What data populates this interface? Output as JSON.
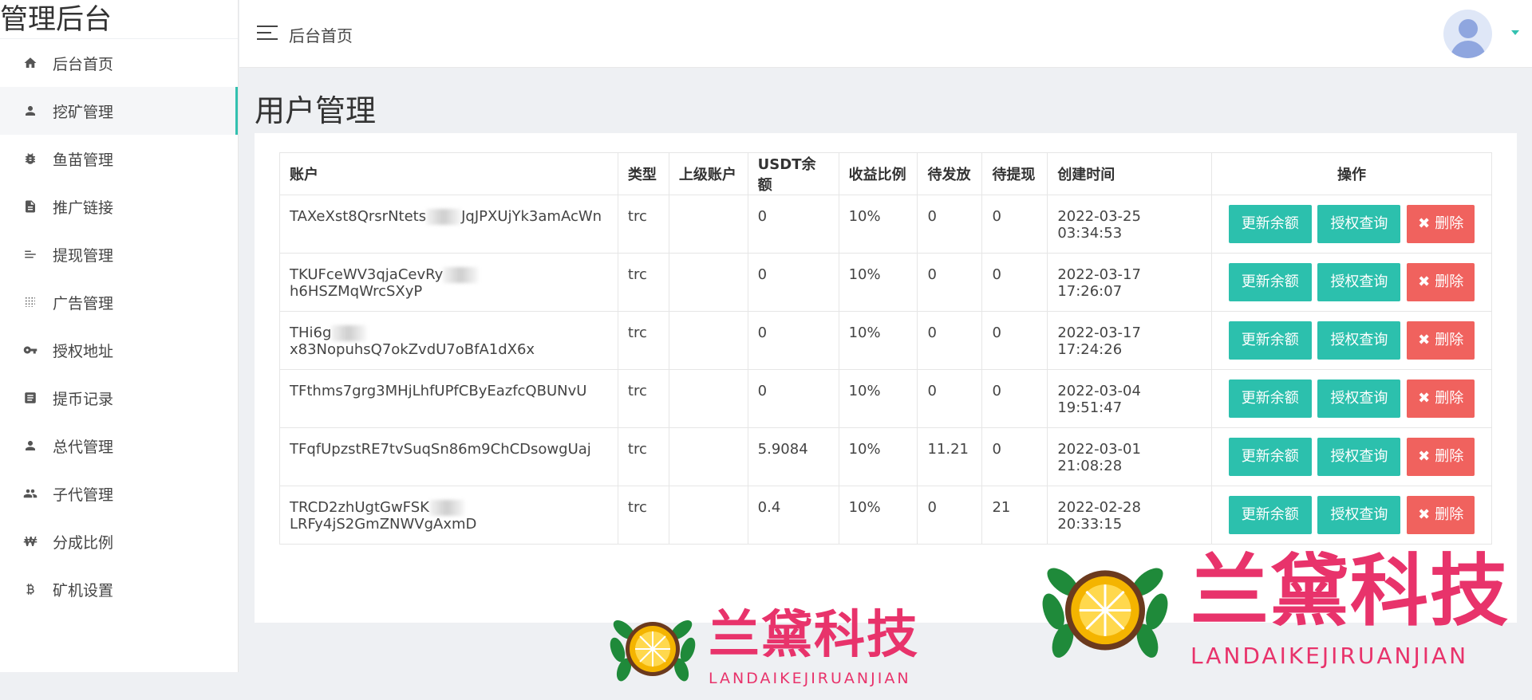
{
  "brand": "管理后台",
  "sidebar": {
    "items": [
      {
        "label": "后台首页",
        "icon": "home-icon"
      },
      {
        "label": "挖矿管理",
        "icon": "person-icon",
        "active": true
      },
      {
        "label": "鱼苗管理",
        "icon": "bug-icon"
      },
      {
        "label": "推广链接",
        "icon": "document-icon"
      },
      {
        "label": "提现管理",
        "icon": "list-icon"
      },
      {
        "label": "广告管理",
        "icon": "grid-dots-icon"
      },
      {
        "label": "授权地址",
        "icon": "key-icon"
      },
      {
        "label": "提币记录",
        "icon": "record-icon"
      },
      {
        "label": "总代管理",
        "icon": "person-icon"
      },
      {
        "label": "子代管理",
        "icon": "people-icon"
      },
      {
        "label": "分成比例",
        "icon": "won-icon"
      },
      {
        "label": "矿机设置",
        "icon": "bitcoin-icon"
      }
    ]
  },
  "header": {
    "title": "后台首页"
  },
  "page": {
    "title": "用户管理"
  },
  "table": {
    "headers": {
      "account": "账户",
      "type": "类型",
      "parent": "上级账户",
      "usdt": "USDT余额",
      "ratio": "收益比例",
      "pending": "待发放",
      "withdraw": "待提现",
      "created": "创建时间",
      "ops": "操作"
    },
    "rows": [
      {
        "account_a": "TAXeXst8QrsrNtets",
        "account_b": "JqJPXUjYk3amAcWn",
        "type": "trc",
        "parent": "",
        "usdt": "0",
        "ratio": "10%",
        "pending": "0",
        "withdraw": "0",
        "created": "2022-03-25 03:34:53"
      },
      {
        "account_a": "TKUFceWV3qjaCevRy",
        "account_b": "h6HSZMqWrcSXyP",
        "type": "trc",
        "parent": "",
        "usdt": "0",
        "ratio": "10%",
        "pending": "0",
        "withdraw": "0",
        "created": "2022-03-17 17:26:07"
      },
      {
        "account_a": "THi6g",
        "account_b": "x83NopuhsQ7okZvdU7oBfA1dX6x",
        "type": "trc",
        "parent": "",
        "usdt": "0",
        "ratio": "10%",
        "pending": "0",
        "withdraw": "0",
        "created": "2022-03-17 17:24:26"
      },
      {
        "account_a": "TFthms7grg3MHjLhfUPfCByEazfcQBUNvU",
        "account_b": "",
        "type": "trc",
        "parent": "",
        "usdt": "0",
        "ratio": "10%",
        "pending": "0",
        "withdraw": "0",
        "created": "2022-03-04 19:51:47"
      },
      {
        "account_a": "TFqfUpzstRE7tvSuqSn86m9ChCDsowgUaj",
        "account_b": "",
        "type": "trc",
        "parent": "",
        "usdt": "5.9084",
        "ratio": "10%",
        "pending": "11.21",
        "withdraw": "0",
        "created": "2022-03-01 21:08:28"
      },
      {
        "account_a": "TRCD2zhUgtGwFSK",
        "account_b": "LRFy4jS2GmZNWVgAxmD",
        "type": "trc",
        "parent": "",
        "usdt": "0.4",
        "ratio": "10%",
        "pending": "0",
        "withdraw": "21",
        "created": "2022-02-28 20:33:15"
      }
    ],
    "buttons": {
      "update_balance": "更新余额",
      "auth_query": "授权查询",
      "delete": "删除",
      "delete_icon": "✖"
    }
  },
  "watermark": {
    "cn": "兰黛科技",
    "en": "LANDAIKEJIRUANJIAN"
  },
  "colors": {
    "accent": "#2cc0ad",
    "danger": "#f0625e",
    "watermark": "#e8336b"
  }
}
